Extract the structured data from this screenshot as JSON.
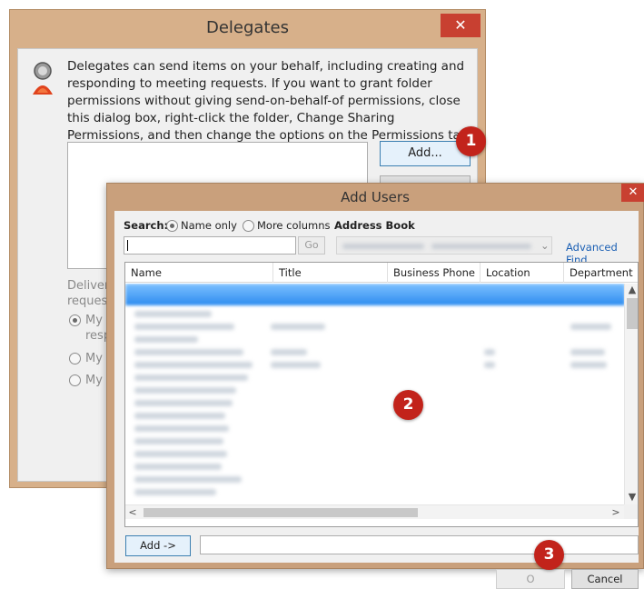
{
  "delegates": {
    "title": "Delegates",
    "close": "✕",
    "description": "Delegates can send items on your behalf, including creating and responding to meeting requests. If you want to grant folder permissions without giving send-on-behalf-of permissions, close this dialog box, right-click the folder, Change Sharing Permissions, and then change the options on the Permissions tab.",
    "add_button": "Add...",
    "deliver_label": "Deliver request",
    "options": [
      "My resp",
      "My",
      "My"
    ]
  },
  "add_users": {
    "title": "Add Users",
    "close": "✕",
    "search_label": "Search:",
    "radio_name_only": "Name only",
    "radio_more_columns": "More columns",
    "address_book_label": "Address Book",
    "search_value": "",
    "go_button": "Go",
    "advanced_find": "Advanced Find",
    "columns": [
      "Name",
      "Title",
      "Business Phone",
      "Location",
      "Department"
    ],
    "add_arrow_button": "Add ->",
    "add_field_value": "",
    "ok_button": "O",
    "cancel_button": "Cancel"
  },
  "callouts": [
    "1",
    "2",
    "3"
  ],
  "icons": {
    "delegates_icon": "delegate-person-icon",
    "scroll_up": "▲",
    "scroll_down": "▼",
    "scroll_left": "<",
    "scroll_right": ">"
  },
  "colors": {
    "window_frame": "#d7b08a",
    "close_button": "#c84031",
    "selection": "#2d8cf0",
    "callout": "#c2231b",
    "link": "#1a5fb4"
  }
}
